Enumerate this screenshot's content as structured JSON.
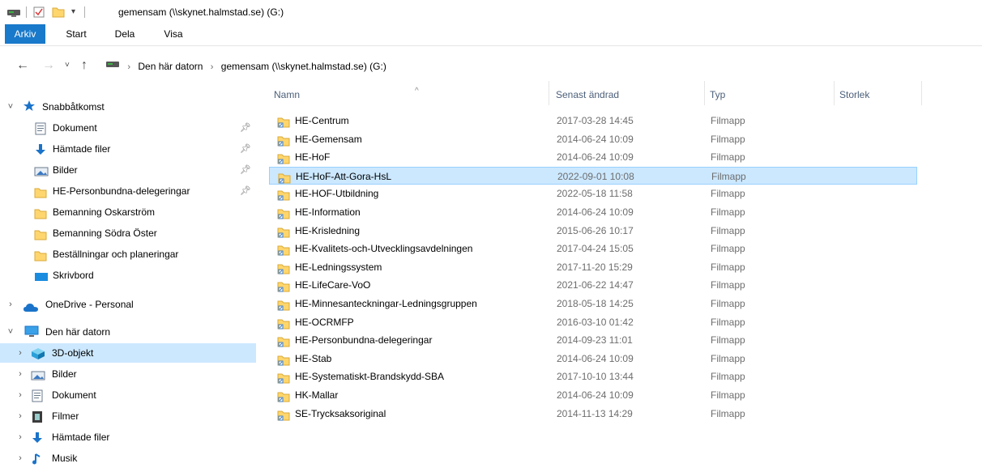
{
  "titlebar": {
    "title": "gemensam (\\\\skynet.halmstad.se) (G:)",
    "quick_access_icons": [
      "drive-icon",
      "properties-icon",
      "new-folder-icon",
      "dropdown-icon"
    ]
  },
  "ribbon": {
    "tabs": [
      "Arkiv",
      "Start",
      "Dela",
      "Visa"
    ]
  },
  "address": {
    "crumbs": [
      "Den här datorn",
      "gemensam (\\\\skynet.halmstad.se) (G:)"
    ]
  },
  "nav": {
    "quick_access": "Snabbåtkomst",
    "quick_items": [
      {
        "label": "Dokument",
        "icon": "documents-icon",
        "pinned": true
      },
      {
        "label": "Hämtade filer",
        "icon": "download-icon",
        "pinned": true
      },
      {
        "label": "Bilder",
        "icon": "pictures-icon",
        "pinned": true
      },
      {
        "label": "HE-Personbundna-delegeringar",
        "icon": "folder-icon",
        "pinned": true
      },
      {
        "label": "Bemanning Oskarström",
        "icon": "folder-icon",
        "pinned": false
      },
      {
        "label": "Bemanning Södra Öster",
        "icon": "folder-icon",
        "pinned": false
      },
      {
        "label": "Beställningar och planeringar",
        "icon": "folder-icon",
        "pinned": false
      },
      {
        "label": "Skrivbord",
        "icon": "desktop-icon",
        "pinned": false
      }
    ],
    "onedrive": "OneDrive - Personal",
    "this_pc": "Den här datorn",
    "pc_items": [
      {
        "label": "3D-objekt",
        "icon": "3d-objects-icon",
        "selected": true
      },
      {
        "label": "Bilder",
        "icon": "pictures-icon",
        "selected": false
      },
      {
        "label": "Dokument",
        "icon": "documents-icon",
        "selected": false
      },
      {
        "label": "Filmer",
        "icon": "videos-icon",
        "selected": false
      },
      {
        "label": "Hämtade filer",
        "icon": "download-icon",
        "selected": false
      },
      {
        "label": "Musik",
        "icon": "music-icon",
        "selected": false
      }
    ]
  },
  "list": {
    "columns": [
      "Namn",
      "Senast ändrad",
      "Typ",
      "Storlek"
    ],
    "rows": [
      {
        "name": "HE-Centrum",
        "date": "2017-03-28 14:45",
        "type": "Filmapp"
      },
      {
        "name": "HE-Gemensam",
        "date": "2014-06-24 10:09",
        "type": "Filmapp"
      },
      {
        "name": "HE-HoF",
        "date": "2014-06-24 10:09",
        "type": "Filmapp"
      },
      {
        "name": "HE-HoF-Att-Gora-HsL",
        "date": "2022-09-01 10:08",
        "type": "Filmapp",
        "selected": true
      },
      {
        "name": "HE-HOF-Utbildning",
        "date": "2022-05-18 11:58",
        "type": "Filmapp"
      },
      {
        "name": "HE-Information",
        "date": "2014-06-24 10:09",
        "type": "Filmapp"
      },
      {
        "name": "HE-Krisledning",
        "date": "2015-06-26 10:17",
        "type": "Filmapp"
      },
      {
        "name": "HE-Kvalitets-och-Utvecklingsavdelningen",
        "date": "2017-04-24 15:05",
        "type": "Filmapp"
      },
      {
        "name": "HE-Ledningssystem",
        "date": "2017-11-20 15:29",
        "type": "Filmapp"
      },
      {
        "name": "HE-LifeCare-VoO",
        "date": "2021-06-22 14:47",
        "type": "Filmapp"
      },
      {
        "name": "HE-Minnesanteckningar-Ledningsgruppen",
        "date": "2018-05-18 14:25",
        "type": "Filmapp"
      },
      {
        "name": "HE-OCRMFP",
        "date": "2016-03-10 01:42",
        "type": "Filmapp"
      },
      {
        "name": "HE-Personbundna-delegeringar",
        "date": "2014-09-23 11:01",
        "type": "Filmapp"
      },
      {
        "name": "HE-Stab",
        "date": "2014-06-24 10:09",
        "type": "Filmapp"
      },
      {
        "name": "HE-Systematiskt-Brandskydd-SBA",
        "date": "2017-10-10 13:44",
        "type": "Filmapp"
      },
      {
        "name": "HK-Mallar",
        "date": "2014-06-24 10:09",
        "type": "Filmapp"
      },
      {
        "name": "SE-Trycksaksoriginal",
        "date": "2014-11-13 14:29",
        "type": "Filmapp"
      }
    ]
  },
  "colors": {
    "file_tab": "#1979ca",
    "selection": "#cce8ff",
    "selection_border": "#99d1ff",
    "folder": "#ffd66e"
  }
}
